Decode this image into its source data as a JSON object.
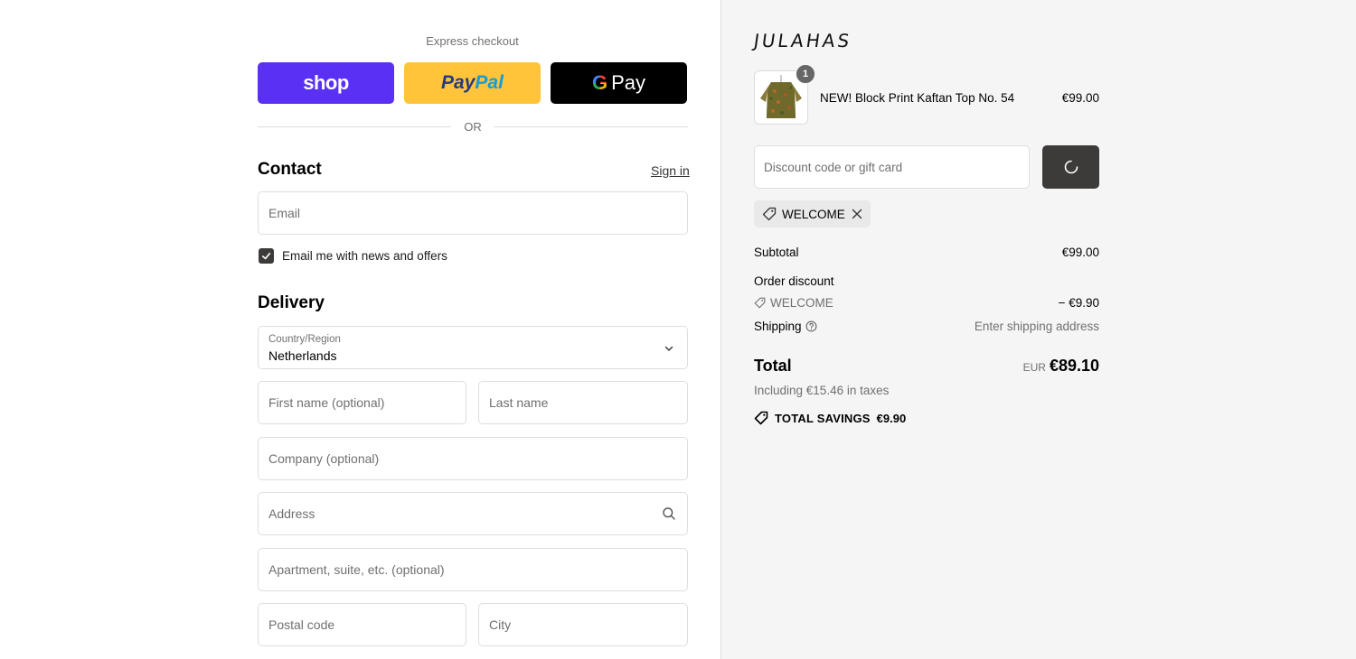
{
  "express": {
    "label": "Express checkout",
    "shop_label": "shop",
    "paypal_part1": "Pay",
    "paypal_part2": "Pal",
    "gpay_g": "G",
    "gpay_label": "Pay",
    "or_label": "OR"
  },
  "contact": {
    "title": "Contact",
    "signin_label": "Sign in",
    "email_placeholder": "Email",
    "newsletter_label": "Email me with news and offers",
    "newsletter_checked": true
  },
  "delivery": {
    "title": "Delivery",
    "country_label": "Country/Region",
    "country_value": "Netherlands",
    "first_name_placeholder": "First name (optional)",
    "last_name_placeholder": "Last name",
    "company_placeholder": "Company (optional)",
    "address_placeholder": "Address",
    "apartment_placeholder": "Apartment, suite, etc. (optional)",
    "postal_placeholder": "Postal code",
    "city_placeholder": "City"
  },
  "summary": {
    "brand": "JULAHAS",
    "item": {
      "quantity": "1",
      "name": "NEW! Block Print Kaftan Top No. 54",
      "price": "€99.00"
    },
    "discount_placeholder": "Discount code or gift card",
    "applied_code": "WELCOME",
    "subtotal_label": "Subtotal",
    "subtotal_value": "€99.00",
    "order_discount_label": "Order discount",
    "discount_code": "WELCOME",
    "discount_value": "− €9.90",
    "shipping_label": "Shipping",
    "shipping_value": "Enter shipping address",
    "total_label": "Total",
    "total_currency": "EUR",
    "total_value": "€89.10",
    "tax_line": "Including €15.46 in taxes",
    "savings_label": "TOTAL SAVINGS",
    "savings_value": "€9.90"
  },
  "colors": {
    "shop_purple": "#5a31f4",
    "paypal_yellow": "#ffc439",
    "gpay_black": "#000000",
    "dark_button": "#3d3a3a",
    "summary_bg": "#f5f5f5"
  }
}
